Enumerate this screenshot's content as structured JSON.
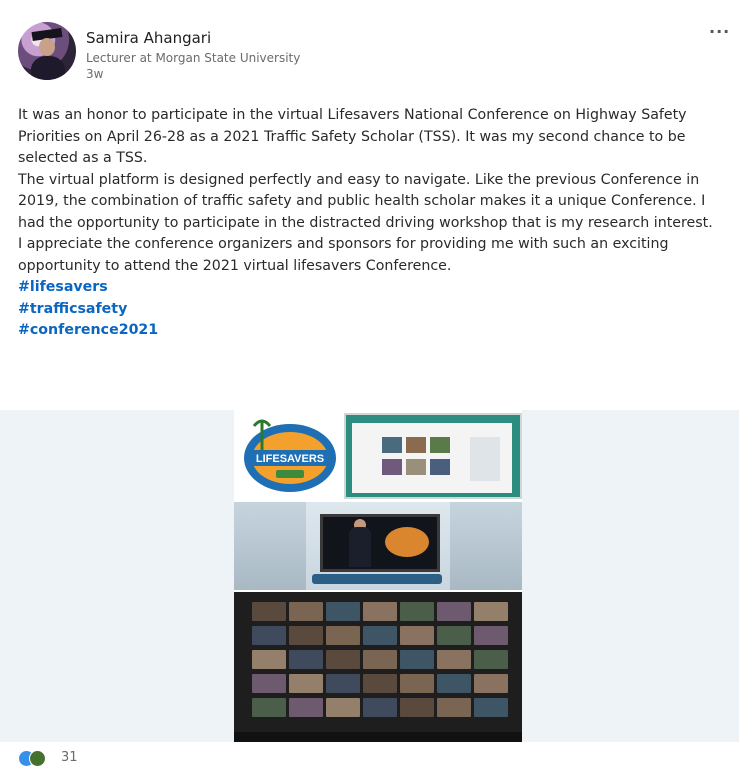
{
  "author": {
    "name": "Samira Ahangari",
    "headline": "Lecturer at Morgan State University",
    "time": "3w"
  },
  "post": {
    "para1": "It was an honor to participate in the virtual Lifesavers National Conference on Highway Safety Priorities on April 26-28 as a 2021 Traffic Safety Scholar (TSS). It was my second chance to be selected as a TSS.",
    "para2": "The virtual platform is designed perfectly and easy to navigate. Like the previous Conference in 2019, the combination of traffic safety and public health scholar makes it a unique Conference. I had the opportunity to participate in the distracted driving workshop that is my research interest.",
    "para3": "I appreciate the conference organizers and sponsors for providing me with such an exciting opportunity to attend the 2021 virtual lifesavers Conference.",
    "hashtags": [
      "#lifesavers",
      "#trafficsafety",
      "#conference2021"
    ]
  },
  "image": {
    "logo_text": "LIFESAVERS"
  },
  "reactions": {
    "icons": [
      "like-icon",
      "celebrate-icon"
    ],
    "count": "31"
  },
  "more_label": "···"
}
